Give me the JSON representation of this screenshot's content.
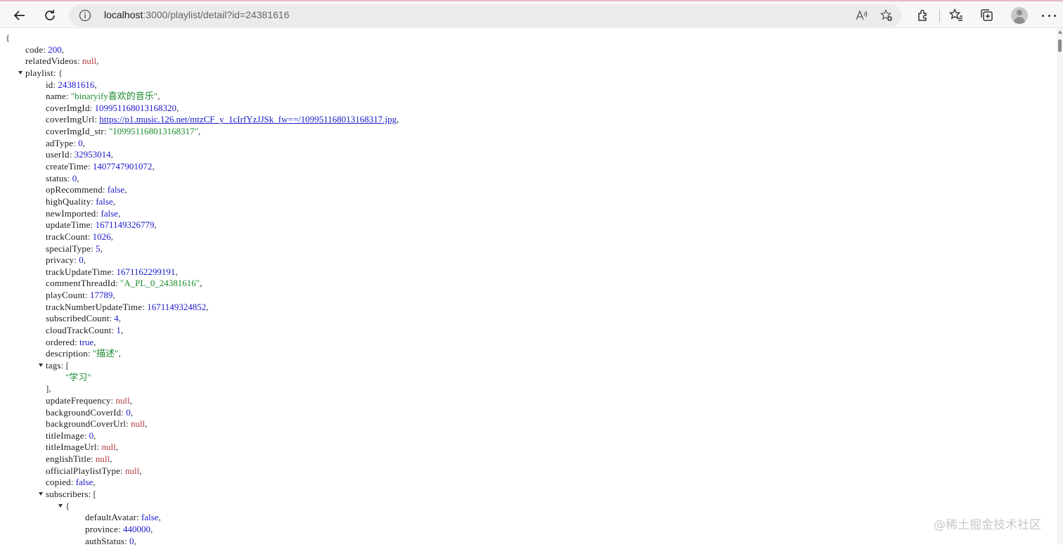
{
  "browser": {
    "url_host": "localhost",
    "url_rest": ":3000/playlist/detail?id=24381616"
  },
  "json": {
    "open_brace": "{",
    "code_key": "code",
    "code_val": "200",
    "relatedVideos_key": "relatedVideos",
    "relatedVideos_val": "null",
    "playlist_key": "playlist",
    "id_key": "id",
    "id_val": "24381616",
    "name_key": "name",
    "name_val": "\"binaryify喜欢的音乐\"",
    "coverImgId_key": "coverImgId",
    "coverImgId_val": "109951168013168320",
    "coverImgUrl_key": "coverImgUrl",
    "coverImgUrl_val": "https://p1.music.126.net/mtzCF_y_1cIrfYzJJSk_fw==/109951168013168317.jpg",
    "coverImgId_str_key": "coverImgId_str",
    "coverImgId_str_val": "\"109951168013168317\"",
    "adType_key": "adType",
    "adType_val": "0",
    "userId_key": "userId",
    "userId_val": "32953014",
    "createTime_key": "createTime",
    "createTime_val": "1407747901072",
    "status_key": "status",
    "status_val": "0",
    "opRecommend_key": "opRecommend",
    "opRecommend_val": "false",
    "highQuality_key": "highQuality",
    "highQuality_val": "false",
    "newImported_key": "newImported",
    "newImported_val": "false",
    "updateTime_key": "updateTime",
    "updateTime_val": "1671149326779",
    "trackCount_key": "trackCount",
    "trackCount_val": "1026",
    "specialType_key": "specialType",
    "specialType_val": "5",
    "privacy_key": "privacy",
    "privacy_val": "0",
    "trackUpdateTime_key": "trackUpdateTime",
    "trackUpdateTime_val": "1671162299191",
    "commentThreadId_key": "commentThreadId",
    "commentThreadId_val": "\"A_PL_0_24381616\"",
    "playCount_key": "playCount",
    "playCount_val": "17789",
    "trackNumberUpdateTime_key": "trackNumberUpdateTime",
    "trackNumberUpdateTime_val": "1671149324852",
    "subscribedCount_key": "subscribedCount",
    "subscribedCount_val": "4",
    "cloudTrackCount_key": "cloudTrackCount",
    "cloudTrackCount_val": "1",
    "ordered_key": "ordered",
    "ordered_val": "true",
    "description_key": "description",
    "description_val": "\"描述\"",
    "tags_key": "tags",
    "tags_item": "\"学习\"",
    "updateFrequency_key": "updateFrequency",
    "updateFrequency_val": "null",
    "backgroundCoverId_key": "backgroundCoverId",
    "backgroundCoverId_val": "0",
    "backgroundCoverUrl_key": "backgroundCoverUrl",
    "backgroundCoverUrl_val": "null",
    "titleImage_key": "titleImage",
    "titleImage_val": "0",
    "titleImageUrl_key": "titleImageUrl",
    "titleImageUrl_val": "null",
    "englishTitle_key": "englishTitle",
    "englishTitle_val": "null",
    "officialPlaylistType_key": "officialPlaylistType",
    "officialPlaylistType_val": "null",
    "copied_key": "copied",
    "copied_val": "false",
    "subscribers_key": "subscribers",
    "defaultAvatar_key": "defaultAvatar",
    "defaultAvatar_val": "false",
    "province_key": "province",
    "province_val": "440000",
    "authStatus_key": "authStatus",
    "authStatus_val": "0"
  },
  "watermark": "@稀土掘金技术社区"
}
